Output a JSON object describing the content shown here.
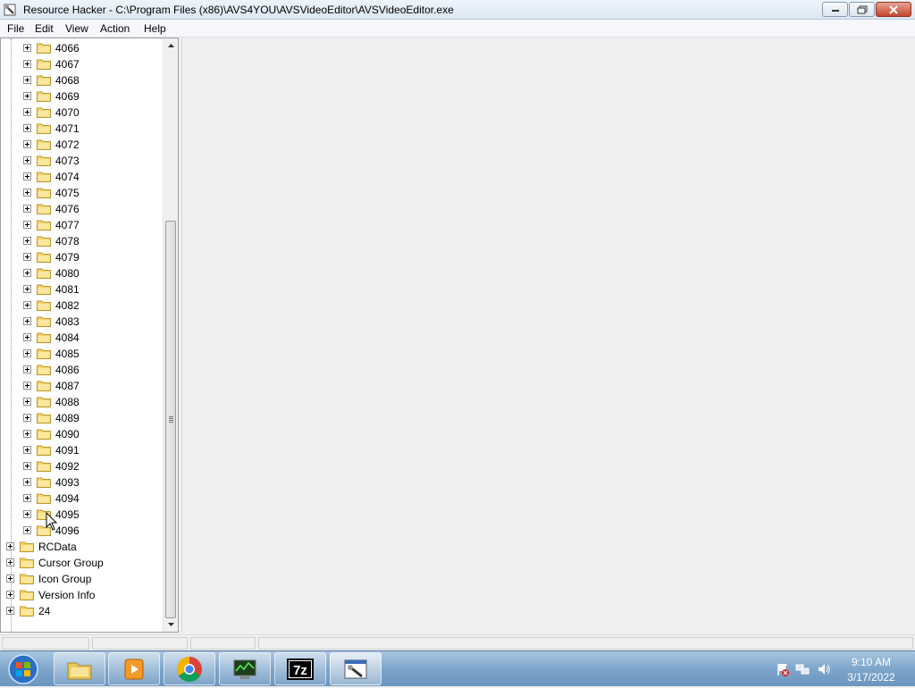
{
  "window": {
    "title": "Resource Hacker  -  C:\\Program Files (x86)\\AVS4YOU\\AVSVideoEditor\\AVSVideoEditor.exe",
    "icon": "resource-hacker-icon"
  },
  "menu": [
    "File",
    "Edit",
    "View",
    "Action",
    "Help"
  ],
  "tree": {
    "children": [
      "4066",
      "4067",
      "4068",
      "4069",
      "4070",
      "4071",
      "4072",
      "4073",
      "4074",
      "4075",
      "4076",
      "4077",
      "4078",
      "4079",
      "4080",
      "4081",
      "4082",
      "4083",
      "4084",
      "4085",
      "4086",
      "4087",
      "4088",
      "4089",
      "4090",
      "4091",
      "4092",
      "4093",
      "4094",
      "4095",
      "4096"
    ],
    "roots": [
      "RCData",
      "Cursor Group",
      "Icon Group",
      "Version Info",
      "24"
    ]
  },
  "taskbar": {
    "apps": [
      "explorer-icon",
      "media-player-icon",
      "chrome-icon",
      "task-manager-icon",
      "7zip-icon",
      "resource-hacker-icon"
    ],
    "seven_zip_label": "7z",
    "clock_time": "9:10 AM",
    "clock_date": "3/17/2022"
  },
  "colors": {
    "folder": "#f5d66b",
    "taskbar": "#7ea6cc",
    "close_button": "#c4452a"
  }
}
